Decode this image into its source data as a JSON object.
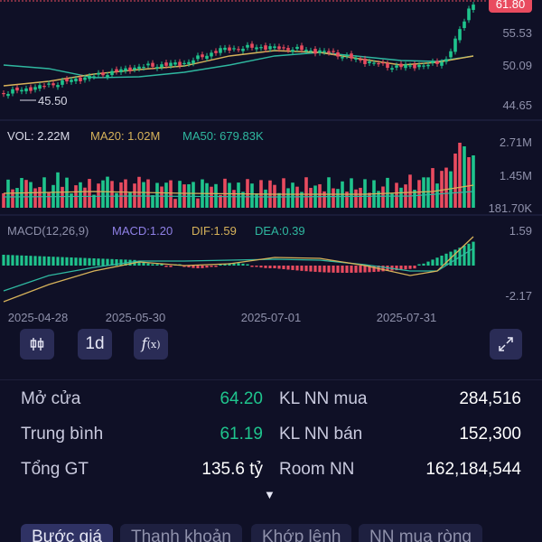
{
  "colors": {
    "background": "#0f1026",
    "up": "#1fc48d",
    "down": "#e94b5f",
    "ma20": "#d6b25a",
    "ma50": "#2fb8a0",
    "axis_text": "#8f91ab",
    "macd_label": "#8f80e6",
    "price_badge": "#e94b5f"
  },
  "price_panel": {
    "current_price": "61.80",
    "axis_labels": [
      "55.53",
      "50.09",
      "44.65"
    ],
    "low_marker": "45.50"
  },
  "volume_panel": {
    "vol": "VOL: 2.22M",
    "ma20": "MA20: 1.02M",
    "ma50": "MA50: 679.83K",
    "axis_labels": [
      "2.71M",
      "1.45M",
      "181.70K"
    ]
  },
  "macd_panel": {
    "title": "MACD(12,26,9)",
    "macd": "MACD:1.20",
    "dif": "DIF:1.59",
    "dea": "DEA:0.39",
    "axis_labels": [
      "1.59",
      "-2.17"
    ]
  },
  "dates": [
    "2025-04-28",
    "2025-05-30",
    "2025-07-01",
    "2025-07-31"
  ],
  "toolbar": {
    "candle_icon": "candlestick-icon",
    "interval": "1d",
    "indicator_icon": "function-icon",
    "fullscreen_icon": "expand-icon"
  },
  "stats": {
    "open_label": "Mở cửa",
    "open_value": "64.20",
    "avg_label": "Trung bình",
    "avg_value": "61.19",
    "total_label": "Tổng GT",
    "total_value": "135.6 tỷ",
    "nn_buy_label": "KL NN mua",
    "nn_buy_value": "284,516",
    "nn_sell_label": "KL NN bán",
    "nn_sell_value": "152,300",
    "room_label": "Room NN",
    "room_value": "162,184,544",
    "expand_symbol": "▼"
  },
  "tabs": [
    "Bước giá",
    "Thanh khoản",
    "Khớp lệnh",
    "NN mua ròng"
  ],
  "chart_data": {
    "type": "candlestick",
    "x": [
      "2025-04-28",
      "2025-05-30",
      "2025-07-01",
      "2025-07-31"
    ],
    "ylim": [
      44.65,
      61.8
    ],
    "ma20_close": [
      47.2,
      49.3,
      51.8,
      53.5,
      53.8,
      53.0,
      50.8,
      51.8,
      54.5
    ],
    "ma50_close": [
      46.5,
      47.7,
      49.0,
      50.6,
      52.0,
      52.6,
      52.0,
      51.5,
      52.3
    ],
    "volume_ylim": [
      181700,
      2710000
    ],
    "macd_ylim": [
      -2.17,
      1.59
    ],
    "grid": false
  }
}
